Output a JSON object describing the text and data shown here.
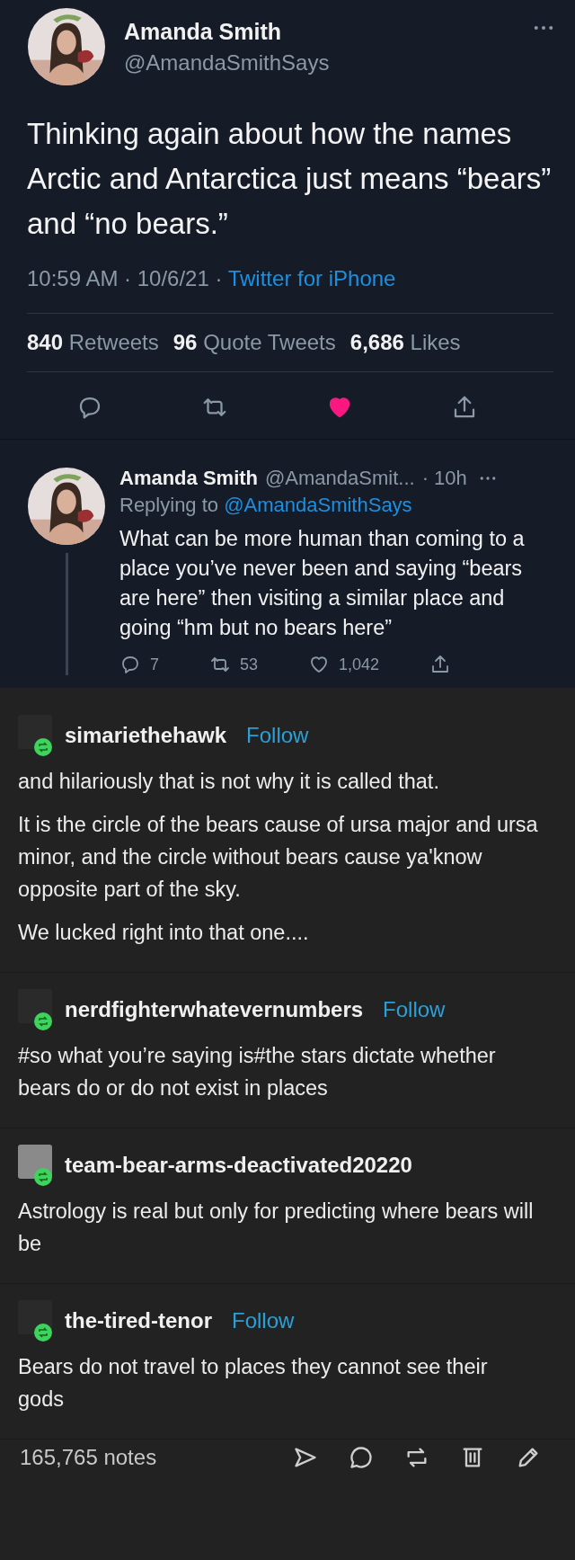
{
  "tweet": {
    "name": "Amanda Smith",
    "handle": "@AmandaSmithSays",
    "text": "Thinking again about how the names Arctic and Antarctica just means “bears” and “no bears.”",
    "time": "10:59 AM · 10/6/21 · ",
    "source": "Twitter for iPhone",
    "stats": [
      {
        "count": "840",
        "label": "Retweets"
      },
      {
        "count": "96",
        "label": "Quote Tweets"
      },
      {
        "count": "6,686",
        "label": "Likes"
      }
    ],
    "liked": true
  },
  "reply": {
    "name": "Amanda Smith",
    "handle": "@AmandaSmit...",
    "age": "· 10h",
    "replying_label": "Replying to",
    "replying_to": "@AmandaSmithSays",
    "text": "What can be more human than coming to a place you’ve never been and saying “bears are here” then visiting a similar place and going “hm but no bears here”",
    "replies": "7",
    "retweets": "53",
    "likes": "1,042",
    "liked": false
  },
  "posts": [
    {
      "user": "simariethehawk",
      "follow": "Follow",
      "color": "#2a2a2a",
      "paragraphs": [
        "and hilariously that is not why it is called that.",
        "It is the circle of the bears cause of ursa major and ursa minor, and the circle without bears cause ya'know opposite part of the sky.",
        "We lucked right into that one...."
      ]
    },
    {
      "user": "nerdfighterwhatevernumbers",
      "follow": "Follow",
      "color": "#2a2a2a",
      "paragraphs": [
        "#so what you’re saying is#the stars dictate whether bears do or do not exist in places"
      ]
    },
    {
      "user": "team-bear-arms-deactivated20220",
      "color": "#8a8a8a",
      "paragraphs": [
        "Astrology is real but only for predicting where bears will be"
      ]
    },
    {
      "user": "the-tired-tenor",
      "follow": "Follow",
      "color": "#2a2a2a",
      "paragraphs": [
        "Bears do not travel to places they cannot see their gods"
      ]
    }
  ],
  "notes": "165,765 notes"
}
